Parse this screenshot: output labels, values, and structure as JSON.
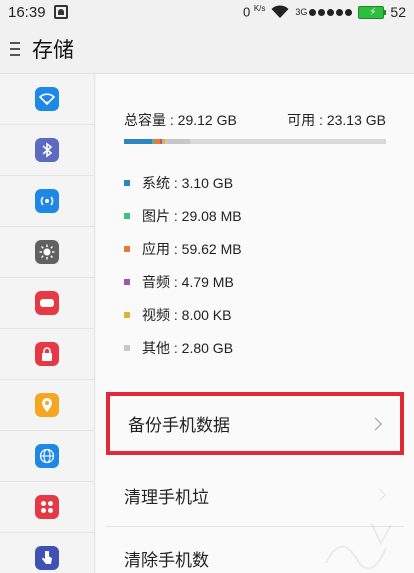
{
  "statusbar": {
    "time": "16:39",
    "net_speed": "0",
    "net_speed_unit": "K/s",
    "signal_type": "3G",
    "battery_level": "52"
  },
  "header": {
    "title": "存储"
  },
  "sidebar": {
    "items": [
      {
        "icon": "wifi-icon",
        "color": "#1e88e5"
      },
      {
        "icon": "bluetooth-icon",
        "color": "#5c6bc0"
      },
      {
        "icon": "hotspot-icon",
        "color": "#1e88e5"
      },
      {
        "icon": "brightness-icon",
        "color": "#616161"
      },
      {
        "icon": "sound-icon",
        "color": "#e53945"
      },
      {
        "icon": "lock-icon",
        "color": "#e53945"
      },
      {
        "icon": "location-icon",
        "color": "#f5a623"
      },
      {
        "icon": "globe-icon",
        "color": "#1e88e5"
      },
      {
        "icon": "apps-icon",
        "color": "#e53945"
      },
      {
        "icon": "accessibility-icon",
        "color": "#3f51b5"
      }
    ]
  },
  "storage": {
    "total_label": "总容量 : 29.12 GB",
    "available_label": "可用 : 23.13 GB",
    "used_fraction": 0.206,
    "segments": [
      {
        "label": "系统 : 3.10 GB",
        "color": "#2e86c1",
        "fraction": 0.106
      },
      {
        "label": "图片 : 29.08 MB",
        "color": "#3ec17a",
        "fraction": 0.01
      },
      {
        "label": "应用 : 59.62 MB",
        "color": "#e57a3c",
        "fraction": 0.02
      },
      {
        "label": "音频 : 4.79 MB",
        "color": "#9b59b6",
        "fraction": 0.01
      },
      {
        "label": "视频 : 8.00 KB",
        "color": "#e3b13a",
        "fraction": 0.01
      },
      {
        "label": "其他 : 2.80 GB",
        "color": "#c7c7c7",
        "fraction": 0.096
      }
    ]
  },
  "actions": {
    "backup": "备份手机数据",
    "clean": "清理手机垃",
    "clear": "清除手机数"
  }
}
